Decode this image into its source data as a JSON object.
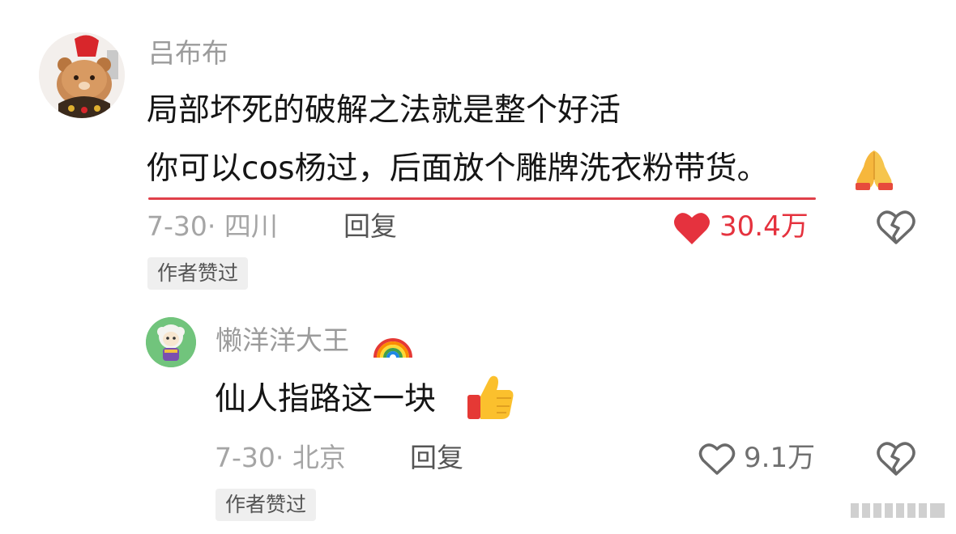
{
  "comment": {
    "username": "吕布布",
    "text_line1": "局部坏死的破解之法就是整个好活",
    "text_line2": "你可以cos杨过，后面放个雕牌洗衣粉带货。",
    "emoji": "pray-icon",
    "date_location": "7-30· 四川",
    "reply_label": "回复",
    "like_count": "30.4万",
    "liked": true,
    "badge": "作者赞过",
    "accent_color": "#e5323e"
  },
  "reply": {
    "username": "懒洋洋大王",
    "name_emoji": "rainbow-icon",
    "text": "仙人指路这一块",
    "emoji": "thumbs-up-icon",
    "date_location": "7-30· 北京",
    "reply_label": "回复",
    "like_count": "9.1万",
    "liked": false,
    "badge": "作者赞过"
  }
}
